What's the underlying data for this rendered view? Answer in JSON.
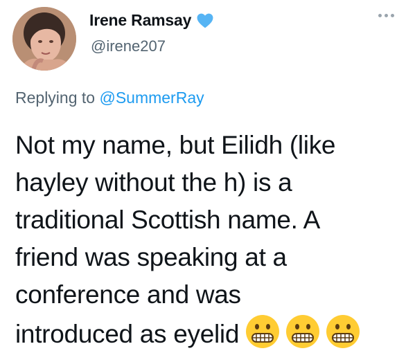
{
  "author": {
    "display_name": "Irene Ramsay",
    "handle": "@irene207",
    "verified": true
  },
  "reply": {
    "prefix": "Replying to",
    "mention": "@SummerRay"
  },
  "tweet": {
    "lines": [
      "Not my name, but Eilidh (like",
      "hayley without the h) is a",
      "traditional Scottish name. A",
      "friend was speaking at a",
      "conference and was",
      "introduced as eyelid"
    ],
    "emojis": [
      "grimacing-face",
      "grimacing-face",
      "grimacing-face"
    ]
  },
  "icons": {
    "verified_color": "#1d9bf0",
    "more": "more-options-icon"
  }
}
